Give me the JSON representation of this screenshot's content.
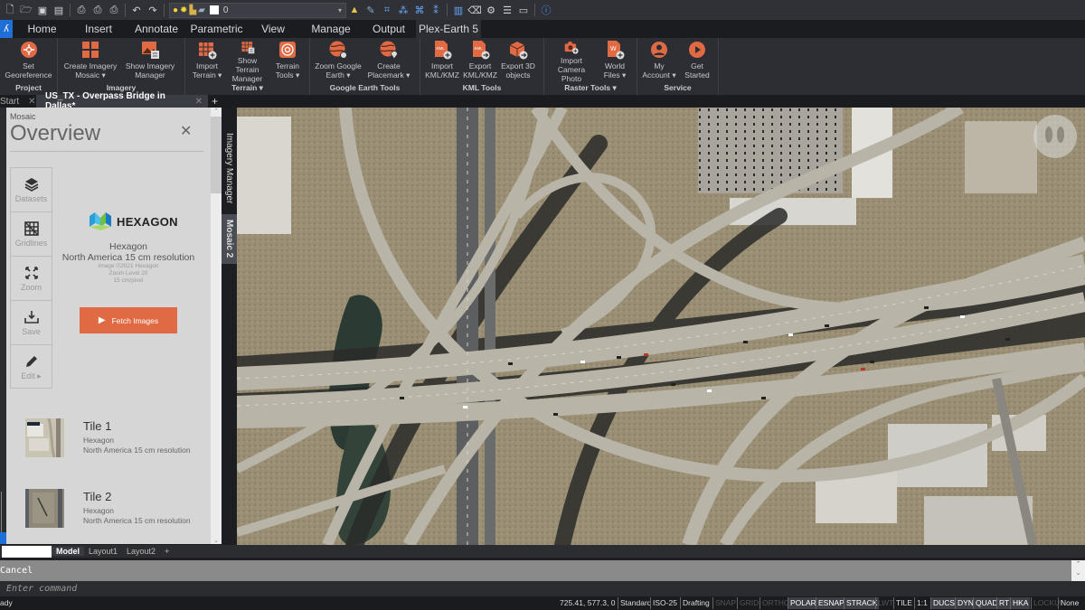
{
  "quick_access": {
    "icons": [
      "new-file-icon",
      "open-file-icon",
      "save-icon",
      "save-as-icon",
      "plot-icon",
      "plot-preview-icon",
      "publish-icon",
      "undo-icon",
      "redo-icon"
    ],
    "layer_value": "0",
    "right_icons": [
      "match-properties-icon",
      "pick-color-icon",
      "select-similar-icon",
      "filter-icon",
      "quick-select-icon",
      "properties-filter-icon",
      "palette-icon",
      "erase-icon",
      "settings-icon",
      "list-icon",
      "image-icon",
      "help-icon"
    ]
  },
  "menu_tabs": [
    {
      "label": "Home"
    },
    {
      "label": "Insert"
    },
    {
      "label": "Annotate"
    },
    {
      "label": "Parametric"
    },
    {
      "label": "View"
    },
    {
      "label": "Manage"
    },
    {
      "label": "Output"
    },
    {
      "label": "Plex-Earth 5",
      "active": true
    }
  ],
  "ribbon": {
    "accent": "#e06a43",
    "panels": [
      {
        "title": "Project",
        "buttons": [
          {
            "line1": "Set",
            "line2": "Georeference"
          }
        ]
      },
      {
        "title": "Imagery",
        "buttons": [
          {
            "line1": "Create Imagery",
            "line2": "Mosaic ▾"
          },
          {
            "line1": "Show Imagery",
            "line2": "Manager"
          }
        ]
      },
      {
        "title": "Terrain ▾",
        "buttons": [
          {
            "line1": "Import",
            "line2": "Terrain ▾"
          },
          {
            "line1": "Show Terrain",
            "line2": "Manager"
          },
          {
            "line1": "Terrain",
            "line2": "Tools ▾"
          }
        ]
      },
      {
        "title": "Google Earth Tools",
        "buttons": [
          {
            "line1": "Zoom Google",
            "line2": "Earth ▾"
          },
          {
            "line1": "Create",
            "line2": "Placemark ▾"
          }
        ]
      },
      {
        "title": "KML Tools",
        "buttons": [
          {
            "line1": "Import",
            "line2": "KML/KMZ"
          },
          {
            "line1": "Export",
            "line2": "KML/KMZ"
          },
          {
            "line1": "Export 3D",
            "line2": "objects"
          }
        ]
      },
      {
        "title": "Raster Tools ▾",
        "buttons": [
          {
            "line1": "Import",
            "line2": "Camera Photo"
          },
          {
            "line1": "World",
            "line2": "Files ▾"
          }
        ]
      },
      {
        "title": "Service",
        "buttons": [
          {
            "line1": "My",
            "line2": "Account ▾"
          },
          {
            "line1": "Get",
            "line2": "Started"
          }
        ]
      }
    ]
  },
  "doc_tabs": {
    "start": "Start",
    "active": "US_TX - Overpass Bridge in Dallas*",
    "add": "+",
    "close": "✕"
  },
  "mosaic_panel": {
    "section": "Mosaic",
    "title": "Overview",
    "close": "✕",
    "tools": [
      {
        "label": "Datasets",
        "icon": "layers-icon"
      },
      {
        "label": "Gridlines",
        "icon": "gridlines-icon"
      },
      {
        "label": "Zoom",
        "icon": "zoom-extents-icon"
      },
      {
        "label": "Save",
        "icon": "download-icon"
      },
      {
        "label": "Edit ▸",
        "icon": "pencil-icon"
      }
    ],
    "provider_logo": "HEXAGON",
    "provider": "Hexagon",
    "dataset": "North America 15 cm resolution",
    "copyright": "Image ©2021 Hexagon",
    "zoom_level": "Zoom Level 20",
    "resolution": "15 cm/pixel",
    "fetch_button": "Fetch Images",
    "tiles": [
      {
        "name": "Tile 1",
        "provider": "Hexagon",
        "dataset": "North America 15 cm resolution"
      },
      {
        "name": "Tile 2",
        "provider": "Hexagon",
        "dataset": "North America 15 cm resolution"
      }
    ]
  },
  "side_tabs": {
    "imagery_manager": "Imagery Manager",
    "mosaic2": "Mosaic 2"
  },
  "layout_tabs": [
    {
      "label": "Model",
      "active": true
    },
    {
      "label": "Layout1"
    },
    {
      "label": "Layout2"
    },
    {
      "label": "+"
    }
  ],
  "command": {
    "history": "Cancel",
    "placeholder": "Enter command"
  },
  "status_bar": {
    "ready": "ady",
    "coordinates": "725.41, 577.3, 0",
    "items": [
      {
        "label": "Standard",
        "state": "text"
      },
      {
        "label": "ISO-25",
        "state": "text"
      },
      {
        "label": "Drafting",
        "state": "text"
      },
      {
        "label": "SNAP",
        "state": "off"
      },
      {
        "label": "GRID",
        "state": "off"
      },
      {
        "label": "ORTHO",
        "state": "off"
      },
      {
        "label": "POLAR",
        "state": "on"
      },
      {
        "label": "ESNAP",
        "state": "on"
      },
      {
        "label": "STRACK",
        "state": "on"
      },
      {
        "label": "LWT",
        "state": "off"
      },
      {
        "label": "TILE",
        "state": "text"
      },
      {
        "label": "1:1",
        "state": "text"
      },
      {
        "label": "DUCS",
        "state": "on"
      },
      {
        "label": "DYN",
        "state": "on"
      },
      {
        "label": "QUAD",
        "state": "on"
      },
      {
        "label": "RT",
        "state": "on"
      },
      {
        "label": "HKA",
        "state": "on"
      },
      {
        "label": "LOCKUI",
        "state": "off"
      },
      {
        "label": "None",
        "state": "text"
      }
    ]
  }
}
